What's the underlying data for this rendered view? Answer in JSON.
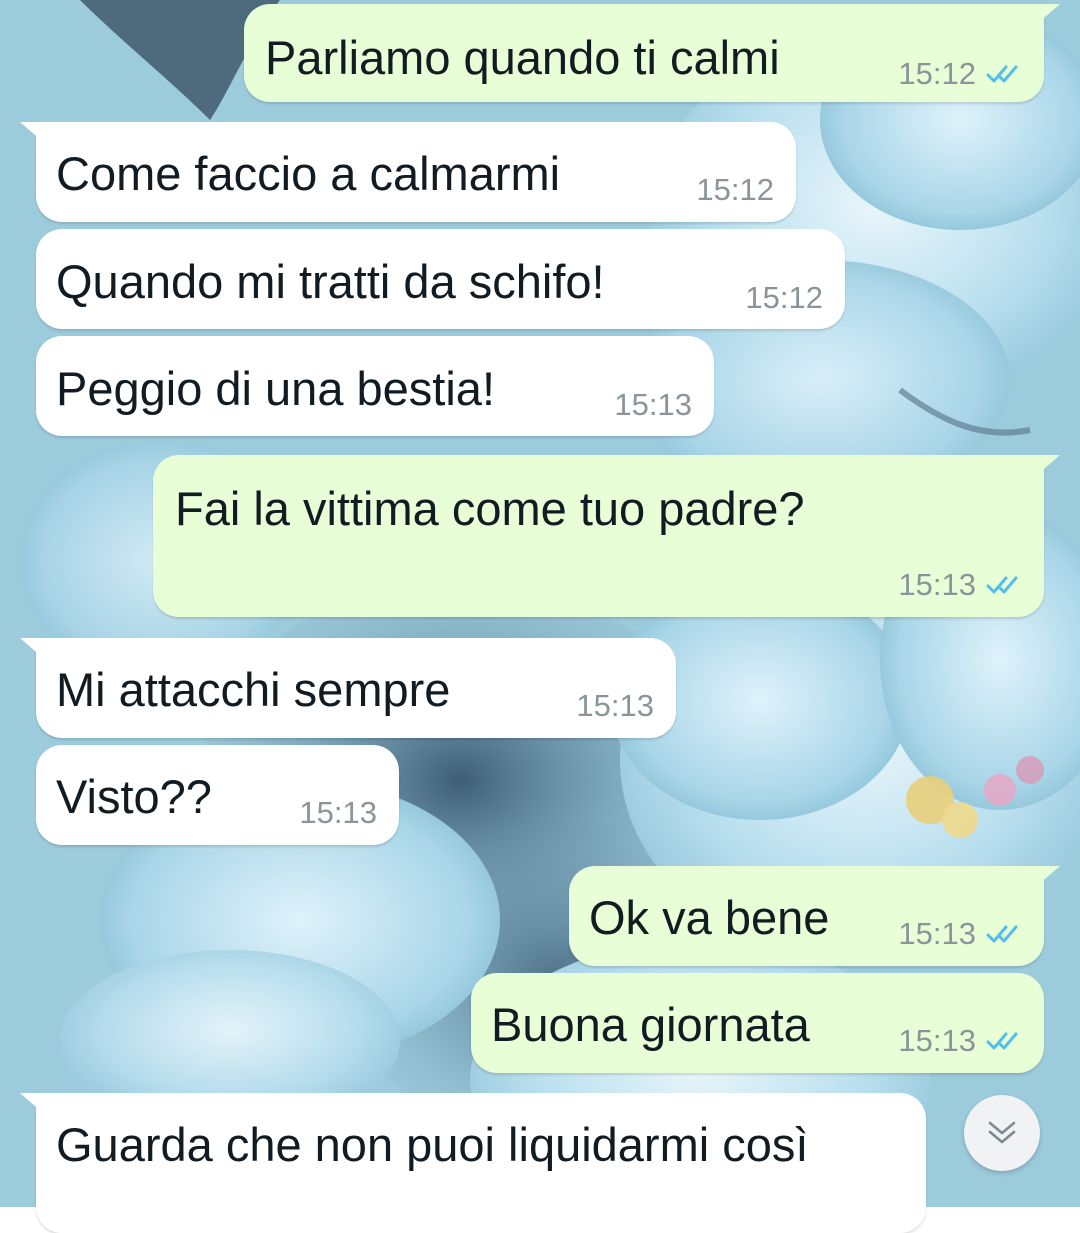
{
  "chat": {
    "messages": [
      {
        "id": "m1",
        "direction": "out",
        "text": "Parliamo quando ti calmi",
        "time": "15:12",
        "status": "read"
      },
      {
        "id": "m2",
        "direction": "in",
        "text": "Come faccio a calmarmi",
        "time": "15:12"
      },
      {
        "id": "m3",
        "direction": "in",
        "text": "Quando mi tratti da schifo!",
        "time": "15:12"
      },
      {
        "id": "m4",
        "direction": "in",
        "text": "Peggio di una bestia!",
        "time": "15:13"
      },
      {
        "id": "m5",
        "direction": "out",
        "text": "Fai la vittima come tuo padre?",
        "time": "15:13",
        "status": "read"
      },
      {
        "id": "m6",
        "direction": "in",
        "text": "Mi attacchi sempre",
        "time": "15:13"
      },
      {
        "id": "m7",
        "direction": "in",
        "text": "Visto??",
        "time": "15:13"
      },
      {
        "id": "m8",
        "direction": "out",
        "text": "Ok va bene",
        "time": "15:13",
        "status": "read"
      },
      {
        "id": "m9",
        "direction": "out",
        "text": "Buona giornata",
        "time": "15:13",
        "status": "read"
      },
      {
        "id": "m10",
        "direction": "in",
        "text": "Guarda che non puoi liquidarmi così",
        "time": ""
      }
    ]
  },
  "colors": {
    "wallpaper": "#9ccbdc",
    "incoming_bubble": "#ffffff",
    "outgoing_bubble": "#e7fed7",
    "read_ticks": "#53bdeb",
    "timestamp": "#8a9499"
  },
  "icons": {
    "read_receipt": "double-check-icon",
    "scroll_down": "chevron-double-down-icon"
  }
}
